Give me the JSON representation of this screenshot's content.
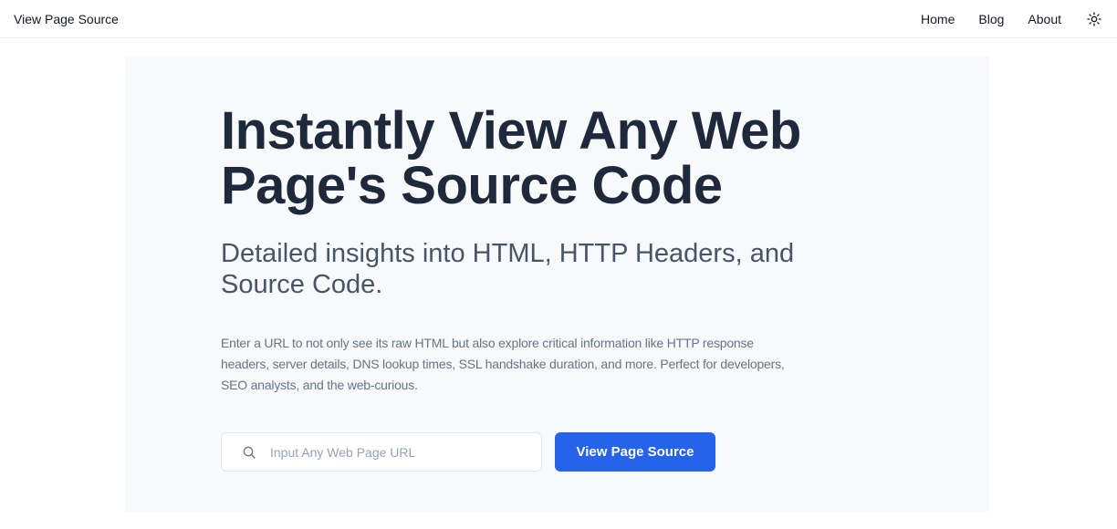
{
  "navbar": {
    "brand": "View Page Source",
    "links": [
      "Home",
      "Blog",
      "About"
    ],
    "theme_icon": "sun-icon"
  },
  "hero": {
    "title": "Instantly View Any Web Page's Source Code",
    "subtitle": "Detailed insights into HTML, HTTP Headers, and Source Code.",
    "description": "Enter a URL to not only see its raw HTML but also explore critical information like HTTP response headers, server details, DNS lookup times, SSL handshake duration, and more. Perfect for developers, SEO analysts, and the web-curious.",
    "search": {
      "placeholder": "Input Any Web Page URL",
      "value": "",
      "icon": "search-icon"
    },
    "submit_label": "View Page Source"
  },
  "colors": {
    "accent": "#2563eb",
    "hero_bg": "#f8f9fb",
    "title": "#1e293b"
  }
}
